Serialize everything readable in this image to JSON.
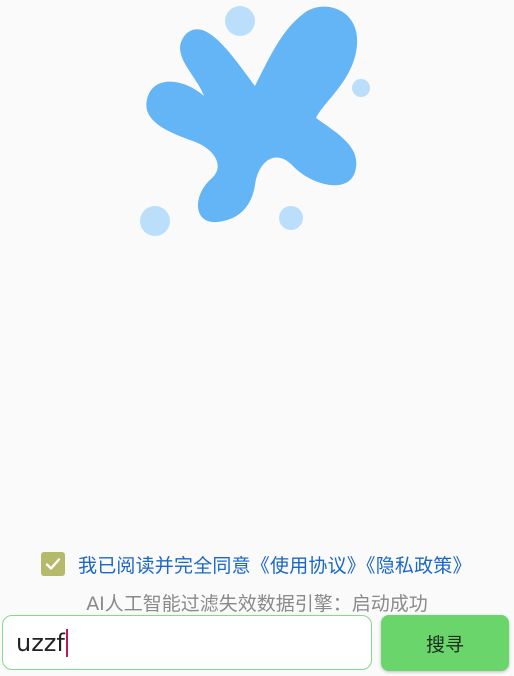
{
  "agreement": {
    "checked": true,
    "label": "我已阅读并完全同意《使用协议》《隐私政策》"
  },
  "status": {
    "text": "AI人工智能过滤失效数据引擎：启动成功"
  },
  "search": {
    "value": "uzzf",
    "button_label": "搜寻"
  },
  "colors": {
    "logo_blob": "#64b5f6",
    "logo_bubble": "#bbdefb",
    "checkbox": "#b5b96a",
    "link_text": "#1a66c9",
    "button": "#69d56b",
    "input_border": "#86d98a"
  }
}
